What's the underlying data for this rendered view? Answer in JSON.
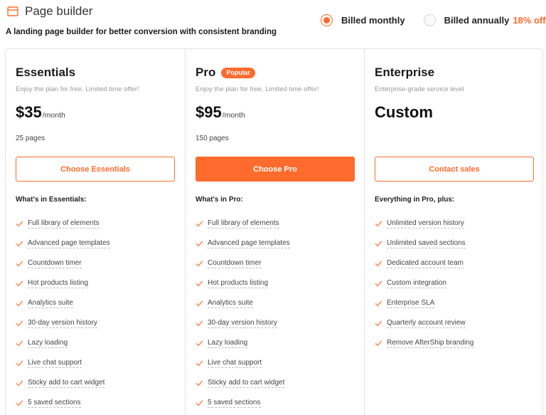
{
  "header": {
    "title": "Page builder",
    "subtitle": "A landing page builder for better conversion with consistent branding"
  },
  "billing": {
    "monthly_label": "Billed monthly",
    "annually_label": "Billed annually",
    "discount": "18% off",
    "selected": "monthly"
  },
  "colors": {
    "accent": "#ff6b2c",
    "border": "#e2e2e2"
  },
  "plans": [
    {
      "name": "Essentials",
      "badge": "",
      "tagline": "Enjoy the plan for free. Limited time offer!",
      "price": "$35",
      "per": "/month",
      "pages": "25 pages",
      "cta": "Choose Essentials",
      "features_heading": "What's in Essentials:",
      "features": [
        "Full library of elements",
        "Advanced page templates",
        "Countdown timer",
        "Hot products listing",
        "Analytics suite",
        "30-day version history",
        "Lazy loading",
        "Live chat support",
        "Sticky add to cart widget",
        "5 saved sections"
      ]
    },
    {
      "name": "Pro",
      "badge": "Popular",
      "tagline": "Enjoy the plan for free. Limited time offer!",
      "price": "$95",
      "per": "/month",
      "pages": "150 pages",
      "cta": "Choose Pro",
      "features_heading": "What's in Pro:",
      "features": [
        "Full library of elements",
        "Advanced page templates",
        "Countdown timer",
        "Hot products listing",
        "Analytics suite",
        "30-day version history",
        "Lazy loading",
        "Live chat support",
        "Sticky add to cart widget",
        "5 saved sections"
      ]
    },
    {
      "name": "Enterprise",
      "badge": "",
      "tagline": "Enterprise-grade service level",
      "price": "Custom",
      "per": "",
      "pages": "",
      "cta": "Contact sales",
      "features_heading": "Everything in Pro, plus:",
      "features": [
        "Unlimited version history",
        "Unlimited saved sections",
        "Dedicated account team",
        "Custom integration",
        "Enterprise SLA",
        "Quarterly account review",
        "Remove AfterShip branding"
      ]
    }
  ]
}
